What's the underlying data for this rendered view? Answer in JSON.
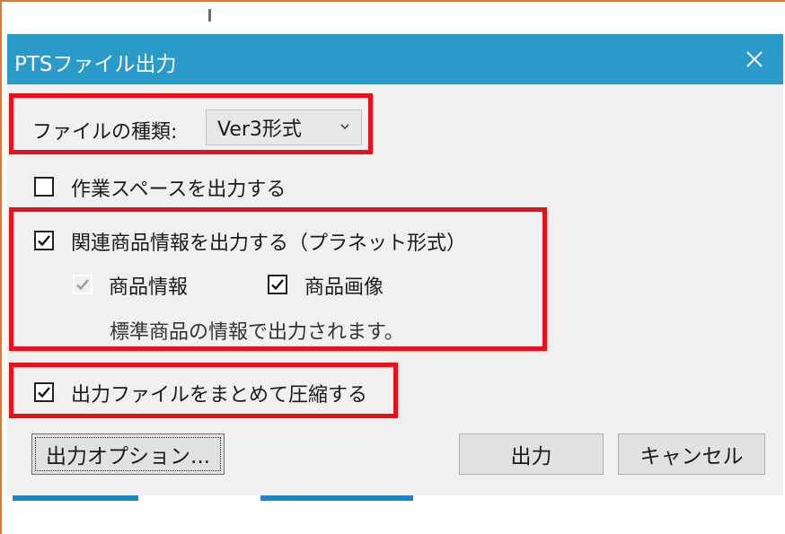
{
  "dialog": {
    "title": "PTSファイル出力",
    "file_type_label": "ファイルの種類:",
    "file_type_value": "Ver3形式",
    "workspace_label": "作業スペースを出力する",
    "workspace_checked": false,
    "related_label": "関連商品情報を出力する（プラネット形式）",
    "related_checked": true,
    "product_info_label": "商品情報",
    "product_info_checked": true,
    "product_info_enabled": false,
    "product_image_label": "商品画像",
    "product_image_checked": true,
    "note": "標準商品の情報で出力されます。",
    "compress_label": "出力ファイルをまとめて圧縮する",
    "compress_checked": true,
    "options_button": "出力オプション...",
    "output_button": "出力",
    "cancel_button": "キャンセル"
  },
  "colors": {
    "titlebar": "#2a9bc8",
    "highlight": "#e8101b",
    "outer_frame": "#e07a2e"
  },
  "icons": {
    "close": "close-icon",
    "dropdown": "chevron-down-icon",
    "check": "checkmark-icon"
  }
}
